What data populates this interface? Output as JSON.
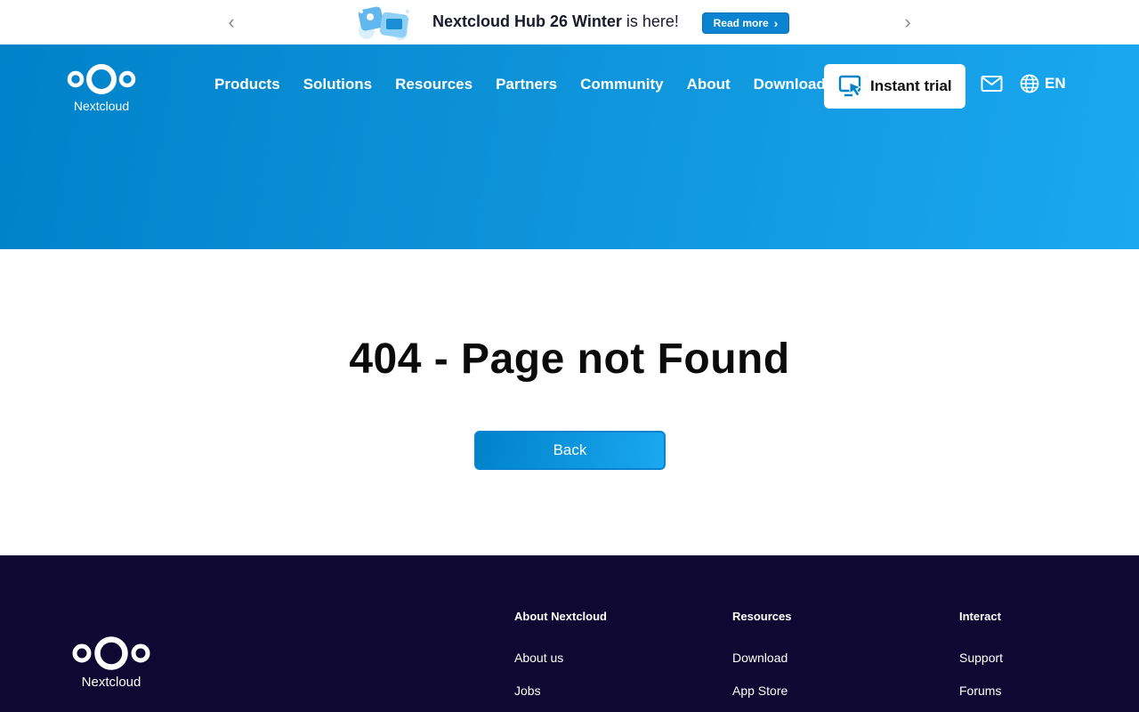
{
  "announcement": {
    "prev_icon": "chevron-left-icon",
    "next_icon": "chevron-right-icon",
    "headline_bold": "Nextcloud Hub 26 Winter",
    "headline_rest": " is here!",
    "button_label": "Read more",
    "button_icon": "chevron-right-icon"
  },
  "header": {
    "logo_text": "Nextcloud",
    "nav": [
      "Products",
      "Solutions",
      "Resources",
      "Partners",
      "Community",
      "About",
      "Download"
    ],
    "trial_label": "Instant trial",
    "trial_icon": "screen-cursor-icon",
    "mail_icon": "mail-icon",
    "language_icon": "globe-icon",
    "language": "EN"
  },
  "main": {
    "title": "404 - Page not Found",
    "back_label": "Back"
  },
  "footer": {
    "logo_text": "Nextcloud",
    "columns": [
      {
        "heading": "About Nextcloud",
        "links": [
          "About us",
          "Jobs"
        ]
      },
      {
        "heading": "Resources",
        "links": [
          "Download",
          "App Store"
        ]
      },
      {
        "heading": "Interact",
        "links": [
          "Support",
          "Forums"
        ]
      }
    ]
  },
  "colors": {
    "brand_blue": "#0082c9",
    "brand_blue_light": "#1aa8f0",
    "footer_bg": "#0f0832"
  }
}
